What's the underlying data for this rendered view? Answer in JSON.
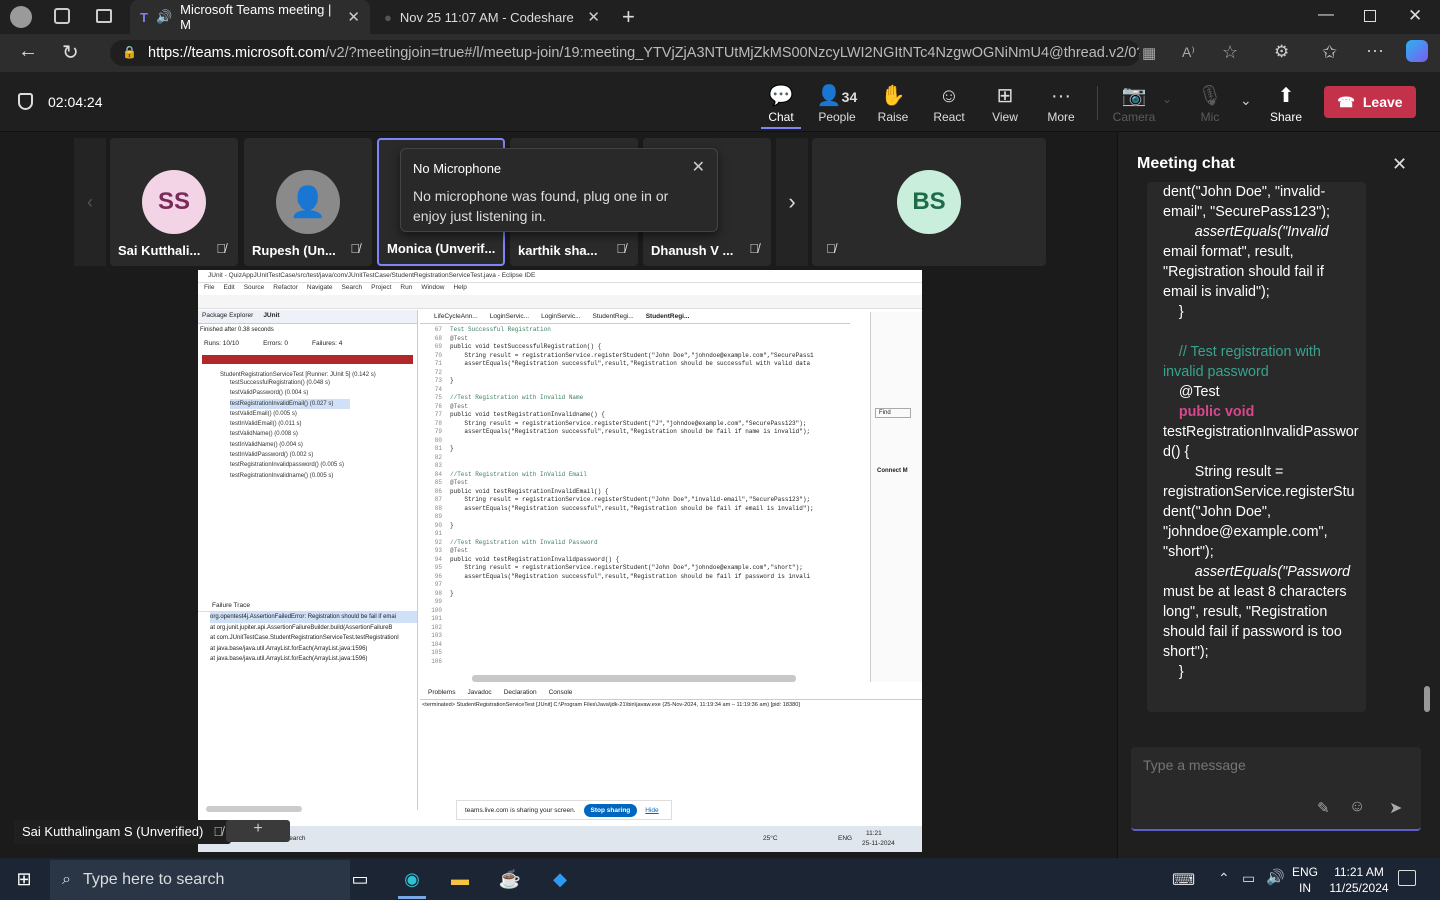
{
  "browser": {
    "tabs": [
      {
        "title": "Microsoft Teams meeting | M",
        "active": true
      },
      {
        "title": "Nov 25 11:07 AM - Codeshare",
        "active": false
      }
    ],
    "url_host": "https://teams.microsoft.com",
    "url_path": "/v2/?meetingjoin=true#/l/meetup-join/19:meeting_YTVjZjA3NTUtMjZkMS00NzcyLWI2NGItNTc4NzgwOGNiNmU4@thread.v2/0?..."
  },
  "meeting": {
    "timer": "02:04:24",
    "people_count": "34",
    "controls": {
      "chat": "Chat",
      "people": "People",
      "raise": "Raise",
      "react": "React",
      "view": "View",
      "more": "More",
      "camera": "Camera",
      "mic": "Mic",
      "share": "Share",
      "leave": "Leave"
    }
  },
  "participants": [
    {
      "initials": "SS",
      "name": "Sai Kutthali...",
      "color": "#f3d4e7",
      "fg": "#7a2a5a"
    },
    {
      "initials": "",
      "name": "Rupesh (Un...",
      "color": "#8a8a8a",
      "fg": "#fff"
    },
    {
      "initials": "",
      "name": "Monica (Unverif...",
      "color": "#8a8a8a",
      "fg": "#fff"
    },
    {
      "initials": "",
      "name": "karthik sha...",
      "color": "#8a8a8a",
      "fg": "#fff"
    },
    {
      "initials": "",
      "name": "Dhanush V ...",
      "color": "#8a8a8a",
      "fg": "#fff"
    },
    {
      "initials": "BS",
      "name": "",
      "color": "#c9eedc",
      "fg": "#1e6b4a"
    }
  ],
  "toast": {
    "title": "No Microphone",
    "body": "No microphone was found, plug one in or enjoy just listening in."
  },
  "presenter_label": "Sai Kutthalingam S (Unverified)",
  "shared_screen": {
    "window_title": "JUnit - QuizAppJUnitTestCase/src/test/java/com/JUnitTestCase/StudentRegistrationServiceTest.java - Eclipse IDE",
    "menu": [
      "File",
      "Edit",
      "Source",
      "Refactor",
      "Navigate",
      "Search",
      "Project",
      "Run",
      "Window",
      "Help"
    ],
    "left_tabs": [
      "Package Explorer",
      "JUnit"
    ],
    "finished": "Finished after 0.38 seconds",
    "runs": "Runs: 10/10",
    "errors": "Errors: 0",
    "failures": "Failures: 4",
    "test_root": "StudentRegistrationServiceTest [Runner: JUnit 5] (0.142 s)",
    "tests": [
      "testSuccessfulRegistration() (0.048 s)",
      "testValidPassword() (0.004 s)",
      "testRegistrationInvalidEmail() (0.027 s)",
      "testValidEmail() (0.005 s)",
      "testInValidEmail() (0.011 s)",
      "testValidName() (0.008 s)",
      "testInValidName() (0.004 s)",
      "testInValidPassword() (0.002 s)",
      "testRegistrationInvalidpassword() (0.005 s)",
      "testRegistrationInvalidname() (0.005 s)"
    ],
    "failure_trace_label": "Failure Trace",
    "trace": [
      "org.opentest4j.AssertionFailedError: Registration should be fail if emai",
      "at org.junit.jupiter.api.AssertionFailureBuilder.build(AssertionFailureB",
      "at com.JUnitTestCase.StudentRegistrationServiceTest.testRegistrationI",
      "at java.base/java.util.ArrayList.forEach(ArrayList.java:1596)",
      "at java.base/java.util.ArrayList.forEach(ArrayList.java:1596)"
    ],
    "editor_tabs": [
      "LifeCycleAnn...",
      "LoginServic...",
      "LoginServic...",
      "StudentRegi...",
      "StudentRegi..."
    ],
    "code": [
      {
        "n": "67",
        "t": "Test Successful Registration",
        "c": "cm"
      },
      {
        "n": "68",
        "t": "@Test",
        "c": "an"
      },
      {
        "n": "69",
        "t": "public void testSuccessfulRegistration() {",
        "c": ""
      },
      {
        "n": "70",
        "t": "    String result = registrationService.registerStudent(\"John Doe\",\"johndoe@example.com\",\"SecurePass1",
        "c": ""
      },
      {
        "n": "71",
        "t": "    assertEquals(\"Registration successful\",result,\"Registration should be successful with valid data",
        "c": ""
      },
      {
        "n": "72",
        "t": "",
        "c": ""
      },
      {
        "n": "73",
        "t": "}",
        "c": ""
      },
      {
        "n": "74",
        "t": "",
        "c": ""
      },
      {
        "n": "75",
        "t": "//Test Registration with Invalid Name",
        "c": "cm"
      },
      {
        "n": "76",
        "t": "@Test",
        "c": "an"
      },
      {
        "n": "77",
        "t": "public void testRegistrationInvalidname() {",
        "c": ""
      },
      {
        "n": "78",
        "t": "    String result = registrationService.registerStudent(\"J\",\"johndoe@example.com\",\"SecurePass123\");",
        "c": ""
      },
      {
        "n": "79",
        "t": "    assertEquals(\"Registration successful\",result,\"Registration should be fail if name is invalid\");",
        "c": ""
      },
      {
        "n": "80",
        "t": "",
        "c": ""
      },
      {
        "n": "81",
        "t": "}",
        "c": ""
      },
      {
        "n": "82",
        "t": "",
        "c": ""
      },
      {
        "n": "83",
        "t": "",
        "c": ""
      },
      {
        "n": "84",
        "t": "//Test Registration with InValid Email",
        "c": "cm"
      },
      {
        "n": "85",
        "t": "@Test",
        "c": "an"
      },
      {
        "n": "86",
        "t": "public void testRegistrationInvalidEmail() {",
        "c": ""
      },
      {
        "n": "87",
        "t": "    String result = registrationService.registerStudent(\"John Doe\",\"invalid-email\",\"SecurePass123\");",
        "c": ""
      },
      {
        "n": "88",
        "t": "    assertEquals(\"Registration successful\",result,\"Registration should be fail if email is invalid\");",
        "c": ""
      },
      {
        "n": "89",
        "t": "",
        "c": ""
      },
      {
        "n": "90",
        "t": "}",
        "c": ""
      },
      {
        "n": "91",
        "t": "",
        "c": ""
      },
      {
        "n": "92",
        "t": "//Test Registration with Invalid Password",
        "c": "cm"
      },
      {
        "n": "93",
        "t": "@Test",
        "c": "an"
      },
      {
        "n": "94",
        "t": "public void testRegistrationInvalidpassword() {",
        "c": ""
      },
      {
        "n": "95",
        "t": "    String result = registrationService.registerStudent(\"John Doe\",\"johndoe@example.com\",\"short\");",
        "c": ""
      },
      {
        "n": "96",
        "t": "    assertEquals(\"Registration successful\",result,\"Registration should be fail if password is invali",
        "c": ""
      },
      {
        "n": "97",
        "t": "",
        "c": ""
      },
      {
        "n": "98",
        "t": "}",
        "c": ""
      },
      {
        "n": "99",
        "t": "",
        "c": ""
      },
      {
        "n": "100",
        "t": "",
        "c": ""
      },
      {
        "n": "101",
        "t": "",
        "c": ""
      },
      {
        "n": "102",
        "t": "",
        "c": ""
      },
      {
        "n": "103",
        "t": "",
        "c": ""
      },
      {
        "n": "104",
        "t": "",
        "c": ""
      },
      {
        "n": "105",
        "t": "",
        "c": ""
      },
      {
        "n": "106",
        "t": "",
        "c": ""
      }
    ],
    "bottom_tabs": [
      "Problems",
      "Javadoc",
      "Declaration",
      "Console"
    ],
    "console_line": "<terminated> StudentRegistrationServiceTest [JUnit] C:\\Program Files\\Java\\jdk-21\\bin\\javaw.exe (25-Nov-2024, 11:19:34 am – 11:19:36 am) [pid: 18380]",
    "sharing_text": "teams.live.com is sharing your screen.",
    "stop_sharing": "Stop sharing",
    "hide": "Hide",
    "find": "Find",
    "connect_label": "Connect M",
    "inner_search": "Type here to search",
    "inner_temp": "25°C",
    "inner_lang": "ENG",
    "inner_time": "11:21",
    "inner_date": "25-11-2024"
  },
  "chat": {
    "title": "Meeting chat",
    "lines": [
      {
        "t": "dent(\"John Doe\", \"invalid-",
        "s": ""
      },
      {
        "t": "email\", \"SecurePass123\");",
        "s": ""
      },
      {
        "t": "        assertEquals(\"Invalid",
        "s": "it"
      },
      {
        "t": "email format\", result,",
        "s": ""
      },
      {
        "t": "\"Registration should fail if",
        "s": ""
      },
      {
        "t": "email is invalid\");",
        "s": ""
      },
      {
        "t": "    }",
        "s": ""
      },
      {
        "t": "",
        "s": ""
      },
      {
        "t": "    // Test registration with",
        "s": "cm"
      },
      {
        "t": "invalid password",
        "s": "cm"
      },
      {
        "t": "    @Test",
        "s": ""
      },
      {
        "t": "    public void",
        "s": "kw"
      },
      {
        "t": "testRegistrationInvalidPasswor",
        "s": ""
      },
      {
        "t": "d() {",
        "s": ""
      },
      {
        "t": "        String result =",
        "s": ""
      },
      {
        "t": "registrationService.registerStu",
        "s": ""
      },
      {
        "t": "dent(\"John Doe\",",
        "s": ""
      },
      {
        "t": "\"johndoe@example.com\",",
        "s": ""
      },
      {
        "t": "\"short\");",
        "s": ""
      },
      {
        "t": "        assertEquals(\"Password",
        "s": "it"
      },
      {
        "t": "must be at least 8 characters",
        "s": ""
      },
      {
        "t": "long\", result, \"Registration",
        "s": ""
      },
      {
        "t": "should fail if password is too",
        "s": ""
      },
      {
        "t": "short\");",
        "s": ""
      },
      {
        "t": "    }",
        "s": ""
      }
    ],
    "placeholder": "Type a message"
  },
  "taskbar": {
    "search": "Type here to search",
    "lang": "ENG",
    "region": "IN",
    "time": "11:21 AM",
    "date": "11/25/2024"
  }
}
